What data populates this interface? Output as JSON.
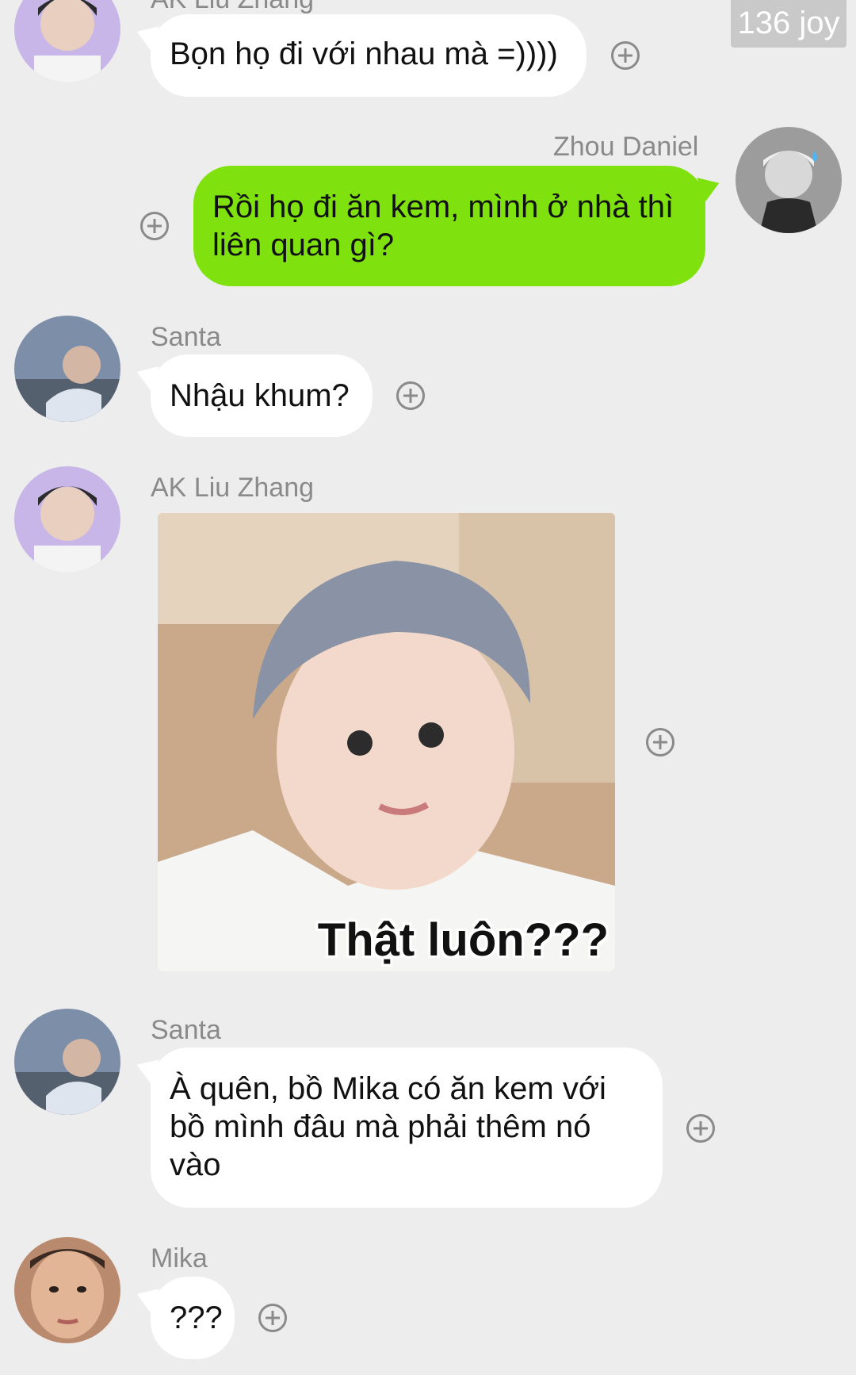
{
  "watermark": "136 joy",
  "messages": {
    "m1": {
      "sender": "AK Liu Zhang",
      "text": "Bọn họ đi với nhau mà =))))"
    },
    "m2": {
      "sender": "Zhou Daniel",
      "line1": "Rồi họ đi ăn kem, mình ở nhà thì",
      "line2": "liên quan gì?"
    },
    "m3": {
      "sender": "Santa",
      "text": "Nhậu khum?"
    },
    "m4": {
      "sender": "AK Liu Zhang",
      "sticker_caption": "Thật luôn???"
    },
    "m5": {
      "sender": "Santa",
      "line1": "À quên, bồ Mika có ăn kem với",
      "line2": "bồ mình đâu mà phải thêm nó",
      "line3": "vào"
    },
    "m6": {
      "sender": "Mika",
      "text": "???"
    }
  },
  "colors": {
    "background": "#ededed",
    "incoming_bubble": "#ffffff",
    "outgoing_bubble": "#7fe20e",
    "name_text": "#8a8a8a"
  },
  "icons": {
    "add": "plus-circle-icon"
  }
}
